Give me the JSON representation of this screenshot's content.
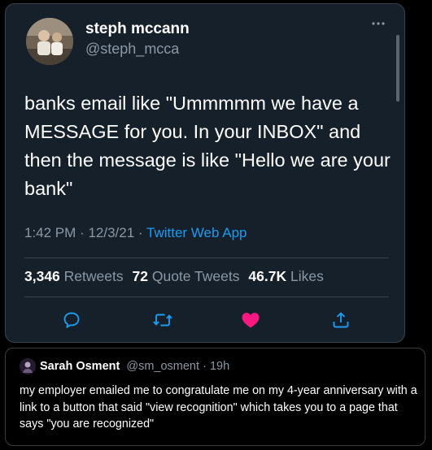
{
  "tweet": {
    "display_name": "steph mccann",
    "handle": "@steph_mcca",
    "text": "banks email like \"Ummmmm we have a MESSAGE for you. In your INBOX\" and then the message is like \"Hello we are your bank\"",
    "time": "1:42 PM",
    "date": "12/3/21",
    "source": "Twitter Web App",
    "separator": "·",
    "retweets_count": "3,346",
    "retweets_label": "Retweets",
    "quote_count": "72",
    "quote_label": "Quote Tweets",
    "likes_count": "46.7K",
    "likes_label": "Likes",
    "actions": [
      {
        "name": "reply-icon",
        "color": "#1d9bf0"
      },
      {
        "name": "retweet-icon",
        "color": "#1d9bf0"
      },
      {
        "name": "heart-icon",
        "color": "#f91880",
        "liked": true
      },
      {
        "name": "share-icon",
        "color": "#1d9bf0"
      }
    ]
  },
  "quote": {
    "display_name": "Sarah Osment",
    "handle": "@sm_osment",
    "separator": "·",
    "time": "19h",
    "text": "my employer emailed me to congratulate me on my 4-year anniversary with a link to a button that said \"view recognition\" which takes you to a page that says \"you are recognized\""
  }
}
